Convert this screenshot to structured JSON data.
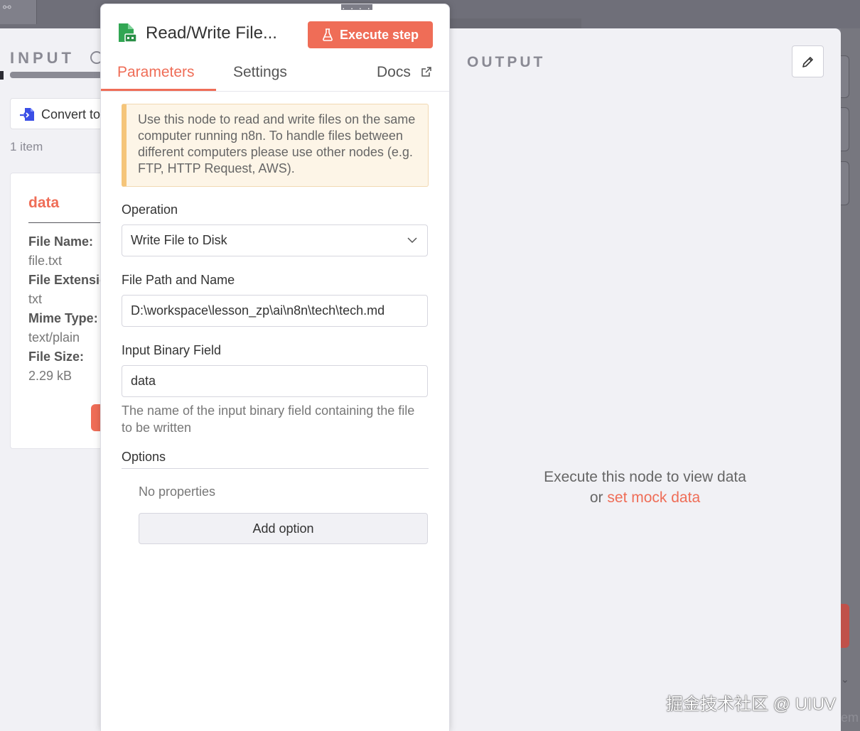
{
  "input_panel": {
    "title": "INPUT",
    "source_node": "Convert to File",
    "item_count": "1 item",
    "card": {
      "title": "data",
      "fields": [
        {
          "key": "File Name:",
          "value": "file.txt"
        },
        {
          "key": "File Extension:",
          "value": "txt"
        },
        {
          "key": "Mime Type:",
          "value": "text/plain"
        },
        {
          "key": "File Size:",
          "value": "2.29 kB"
        }
      ]
    }
  },
  "node_panel": {
    "node_name": "Read/Write File...",
    "execute_label": "Execute step",
    "tabs": {
      "parameters": "Parameters",
      "settings": "Settings",
      "docs": "Docs"
    },
    "notice": "Use this node to read and write files on the same computer running n8n. To handle files between different computers please use other nodes (e.g. FTP, HTTP Request, AWS).",
    "operation": {
      "label": "Operation",
      "value": "Write File to Disk"
    },
    "file_path": {
      "label": "File Path and Name",
      "value": "D:\\workspace\\lesson_zp\\ai\\n8n\\tech\\tech.md"
    },
    "binary_field": {
      "label": "Input Binary Field",
      "value": "data",
      "hint": "The name of the input binary field containing the file to be written"
    },
    "options": {
      "label": "Options",
      "empty": "No properties",
      "add_label": "Add option"
    }
  },
  "output_panel": {
    "title": "OUTPUT",
    "empty_line1": "Execute this node to view data",
    "empty_prefix": "or ",
    "empty_link": "set mock data"
  },
  "watermark": "掘金技术社区 @ UIUV",
  "icons": {
    "node": "file-icon",
    "convert": "convert-to-file-icon",
    "execute": "flask-icon",
    "docs": "external-link-icon",
    "edit": "pencil-icon",
    "dropdown": "chevron-down-icon"
  },
  "colors": {
    "accent": "#ef6d57",
    "node_icon": "#31a653",
    "convert_icon": "#3b4fe6",
    "notice_bg": "#fdf5e7",
    "notice_border": "#f5c57a"
  }
}
